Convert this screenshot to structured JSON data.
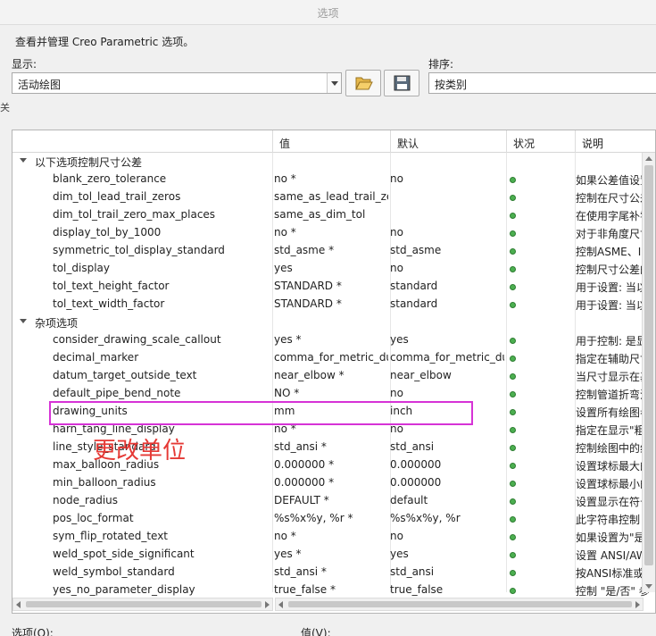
{
  "window": {
    "title": "选项"
  },
  "description": "查看并管理 Creo Parametric 选项。",
  "display": {
    "label": "显示:",
    "value": "活动绘图"
  },
  "sort": {
    "label": "排序:",
    "value": "按类别"
  },
  "toolbar": {
    "open_icon": "folder-open-icon",
    "save_icon": "floppy-disk-icon"
  },
  "side_char": "关",
  "columns": [
    "",
    "值",
    "默认",
    "状况",
    "说明"
  ],
  "groups": [
    {
      "label": "以下选项控制尺寸公差",
      "rows": [
        {
          "name": "blank_zero_tolerance",
          "value": "no *",
          "default": "no",
          "desc": "如果公差值设置"
        },
        {
          "name": "dim_tol_lead_trail_zeros",
          "value": "same_as_lead_trail_zeros",
          "default": "",
          "desc": "控制在尺寸公差"
        },
        {
          "name": "dim_tol_trail_zero_max_places",
          "value": "same_as_dim_tol",
          "default": "",
          "desc": "在使用字尾补零"
        },
        {
          "name": "display_tol_by_1000",
          "value": "no *",
          "default": "no",
          "desc": "对于非角度尺寸"
        },
        {
          "name": "symmetric_tol_display_standard",
          "value": "std_asme *",
          "default": "std_asme",
          "desc": "控制ASME、ISO"
        },
        {
          "name": "tol_display",
          "value": "yes",
          "default": "no",
          "desc": "控制尺寸公差的"
        },
        {
          "name": "tol_text_height_factor",
          "value": "STANDARD *",
          "default": "standard",
          "desc": "用于设置: 当以\""
        },
        {
          "name": "tol_text_width_factor",
          "value": "STANDARD *",
          "default": "standard",
          "desc": "用于设置: 当以\""
        }
      ]
    },
    {
      "label": "杂项选项",
      "rows": [
        {
          "name": "consider_drawing_scale_callout",
          "value": "yes *",
          "default": "yes",
          "desc": "用于控制: 是显示"
        },
        {
          "name": "decimal_marker",
          "value": "comma_for_metric_dual",
          "default": "comma_for_metric_dual",
          "desc": "指定在辅助尺寸"
        },
        {
          "name": "datum_target_outside_text",
          "value": "near_elbow *",
          "default": "near_elbow",
          "desc": "当尺寸显示在基"
        },
        {
          "name": "default_pipe_bend_note",
          "value": "NO *",
          "default": "no",
          "desc": "控制管道折弯注"
        },
        {
          "name": "drawing_units",
          "value": "mm",
          "default": "inch",
          "desc": "设置所有绘图参"
        },
        {
          "name": "harn_tang_line_display",
          "value": "no *",
          "default": "no",
          "desc": "指定在显示\"粗线"
        },
        {
          "name": "line_style_standard",
          "value": "std_ansi *",
          "default": "std_ansi",
          "desc": "控制绘图中的线"
        },
        {
          "name": "max_balloon_radius",
          "value": "0.000000 *",
          "default": "0.000000",
          "desc": "设置球标最大的"
        },
        {
          "name": "min_balloon_radius",
          "value": "0.000000 *",
          "default": "0.000000",
          "desc": "设置球标最小的"
        },
        {
          "name": "node_radius",
          "value": "DEFAULT *",
          "default": "default",
          "desc": "设置显示在符号"
        },
        {
          "name": "pos_loc_format",
          "value": "%s%x%y, %r *",
          "default": "%s%x%y, %r",
          "desc": "此字符串控制 &"
        },
        {
          "name": "sym_flip_rotated_text",
          "value": "no *",
          "default": "no",
          "desc": "如果设置为\"是\""
        },
        {
          "name": "weld_spot_side_significant",
          "value": "yes *",
          "default": "yes",
          "desc": "设置 ANSI/AWS"
        },
        {
          "name": "weld_symbol_standard",
          "value": "std_ansi *",
          "default": "std_ansi",
          "desc": "按ANSI标准或IS"
        },
        {
          "name": "yes_no_parameter_display",
          "value": "true_false *",
          "default": "true_false",
          "desc": "控制 \"是/否\" 参"
        }
      ]
    }
  ],
  "status_color": "#4caf50",
  "highlight_color": "#d633d6",
  "annotation": {
    "text": "更改单位",
    "color": "#e53935"
  },
  "bottom": {
    "option_label": "选项(O):",
    "value_label": "值(V):"
  }
}
